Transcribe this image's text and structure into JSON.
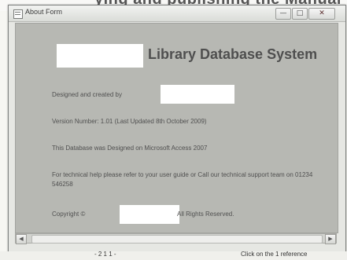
{
  "page_fragment": {
    "top_text": "ying and publishing the Manual",
    "bottom_left": "- 2 1 1 -",
    "bottom_right": "Click on the 1 reference"
  },
  "window": {
    "title": "About Form",
    "controls": {
      "minimize": "—",
      "maximize": "□",
      "close": "✕"
    }
  },
  "form": {
    "app_title": "Library Database System",
    "designed_by_prefix": "Designed and created by",
    "version_line": "Version Number: 1.01 (Last Updated 8th October 2009)",
    "database_line": "This Database was Designed on Microsoft Access 2007",
    "support_line": "For technical help please refer to your user guide or Call our technical support team on 01234 546258",
    "copyright_prefix": "Copyright ©",
    "copyright_suffix": "All Rights Reserved."
  }
}
